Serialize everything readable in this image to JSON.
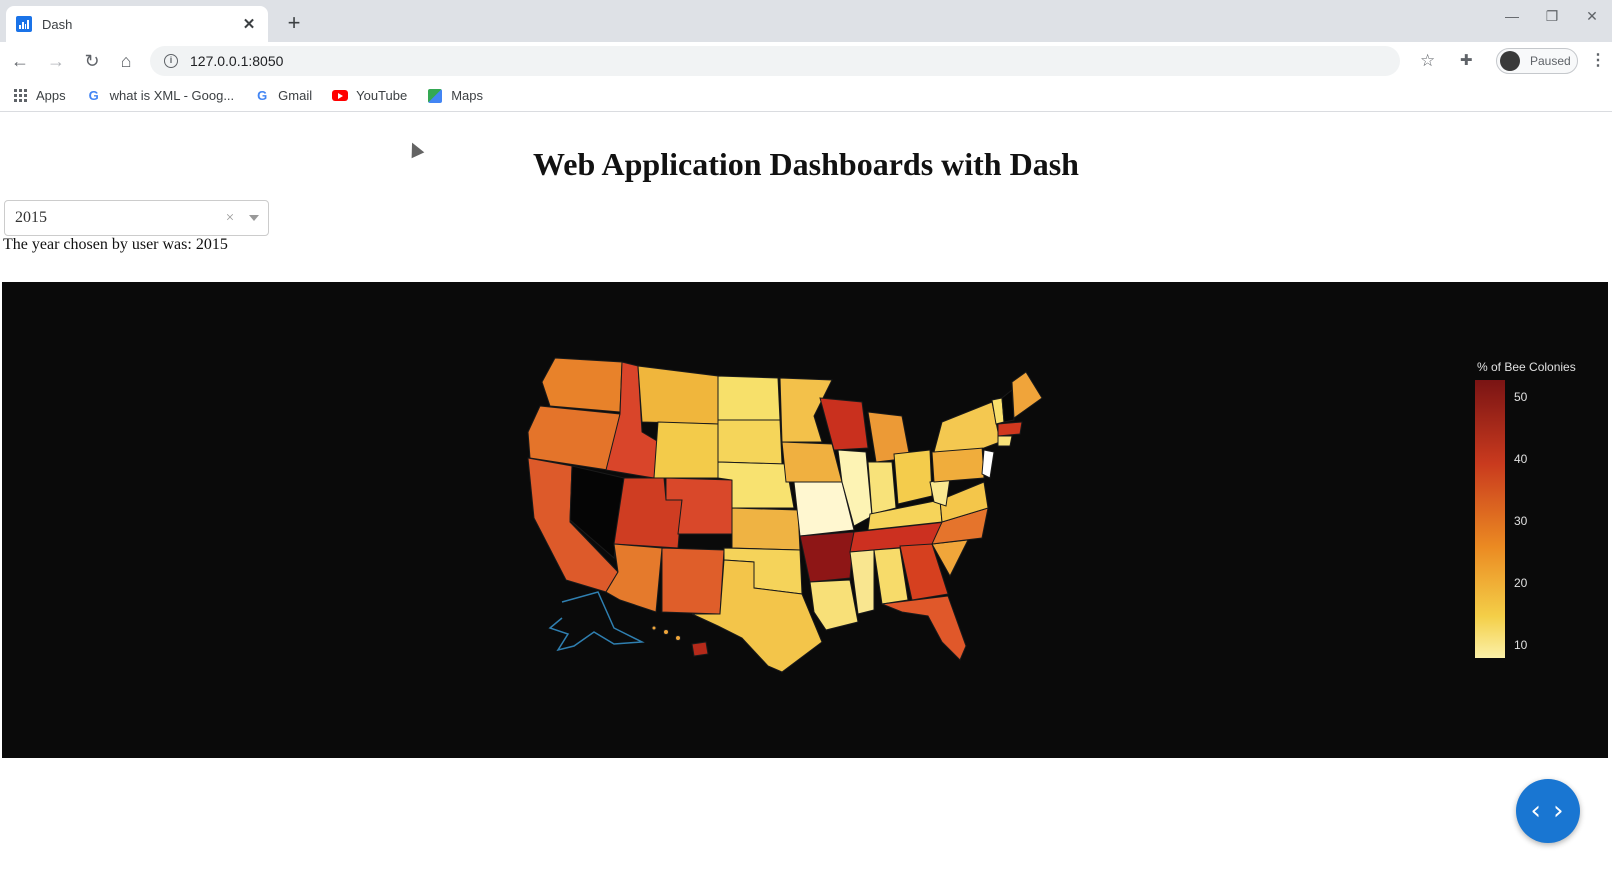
{
  "tab": {
    "title": "Dash",
    "close": "✕",
    "new_tab": "+"
  },
  "window": {
    "minimize": "—",
    "restore": "❐",
    "close": "✕"
  },
  "toolbar": {
    "back": "←",
    "forward": "→",
    "reload": "↻",
    "home": "⌂",
    "url": "127.0.0.1:8050",
    "profile_status": "Paused"
  },
  "bookmarks": [
    {
      "label": "Apps",
      "icon": "apps-grid-icon"
    },
    {
      "label": "what is XML - Goog...",
      "icon": "google-icon"
    },
    {
      "label": "Gmail",
      "icon": "google-icon"
    },
    {
      "label": "YouTube",
      "icon": "youtube-icon"
    },
    {
      "label": "Maps",
      "icon": "maps-icon"
    }
  ],
  "page": {
    "title": "Web Application Dashboards with Dash",
    "dropdown": {
      "value": "2015",
      "clear": "×"
    },
    "output_text": "The year chosen by user was: 2015"
  },
  "chart_data": {
    "type": "choropleth",
    "scope": "usa",
    "colorscale": "YlOrRd",
    "colorbar": {
      "title": "% of Bee Colonies",
      "tick_labels": [
        "50",
        "40",
        "30",
        "20",
        "10"
      ]
    },
    "background": "#0a0a0a",
    "colors": {
      "high": "#8b1a1a",
      "mid": "#e8602c",
      "low": "#fff6b0"
    }
  },
  "fab": {
    "label": "‹ ›"
  }
}
